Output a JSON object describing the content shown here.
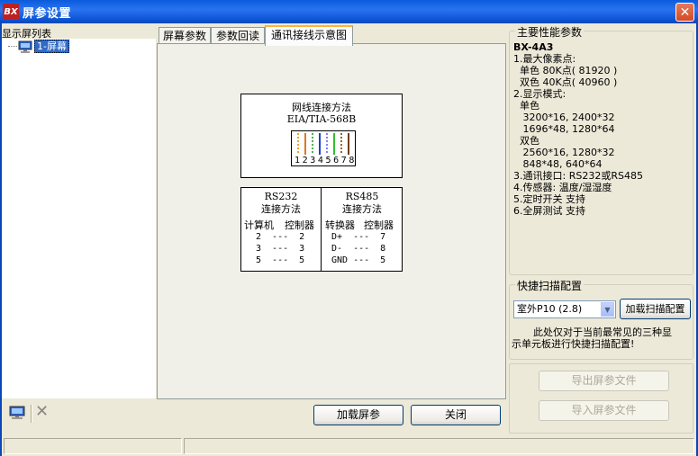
{
  "window": {
    "title": "屏参设置",
    "app_icon_text": "BX",
    "close_symbol": "✕"
  },
  "left_panel": {
    "list_label": "显示屏列表",
    "items": [
      {
        "label": "1-屏幕",
        "selected": true
      }
    ],
    "toolbar": {
      "monitor_icon": "monitor-icon",
      "delete_symbol": "✕"
    }
  },
  "tabs": [
    {
      "label": "屏幕参数",
      "active": false
    },
    {
      "label": "参数回读",
      "active": false
    },
    {
      "label": "通讯接线示意图",
      "active": true
    }
  ],
  "diagram": {
    "ethernet": {
      "title": "网线连接方法",
      "standard": "EIA/TIA-568B",
      "pins": "12345678",
      "wire_colors": [
        "#f0a030",
        "#e07820",
        "#50b050",
        "#2040d0",
        "#8080ff",
        "#30c030",
        "#a06030",
        "#704020"
      ]
    },
    "rs232": {
      "title": "RS232",
      "subtitle": "连接方法",
      "col1": "计算机",
      "col2": "控制器",
      "rows": [
        "2  ---  2",
        "3  ---  3",
        "5  ---  5"
      ]
    },
    "rs485": {
      "title": "RS485",
      "subtitle": "连接方法",
      "col1": "转换器",
      "col2": "控制器",
      "rows": [
        "D+  ---  7",
        "D-  ---  8",
        "GND ---  5"
      ]
    }
  },
  "buttons": {
    "load_params": "加载屏参",
    "close": "关闭"
  },
  "specs": {
    "title": "主要性能参数",
    "model": "BX-4A3",
    "lines": [
      "1.最大像素点:",
      "  单色 80K点( 81920 )",
      "  双色 40K点( 40960 )",
      "2.显示模式:",
      "  单色",
      "   3200*16, 2400*32",
      "   1696*48, 1280*64",
      "  双色",
      "   2560*16, 1280*32",
      "   848*48, 640*64",
      "3.通讯接口: RS232或RS485",
      "4.传感器: 温度/湿湿度",
      "5.定时开关 支持",
      "6.全屏测试 支持"
    ]
  },
  "quick_scan": {
    "title": "快捷扫描配置",
    "selected_option": "室外P10 (2.8)",
    "load_button": "加载扫描配置",
    "note_line1": "此处仅对于当前最常见的三种显",
    "note_line2": "示单元板进行快捷扫描配置!"
  },
  "file_buttons": {
    "export": "导出屏参文件",
    "import": "导入屏参文件"
  }
}
